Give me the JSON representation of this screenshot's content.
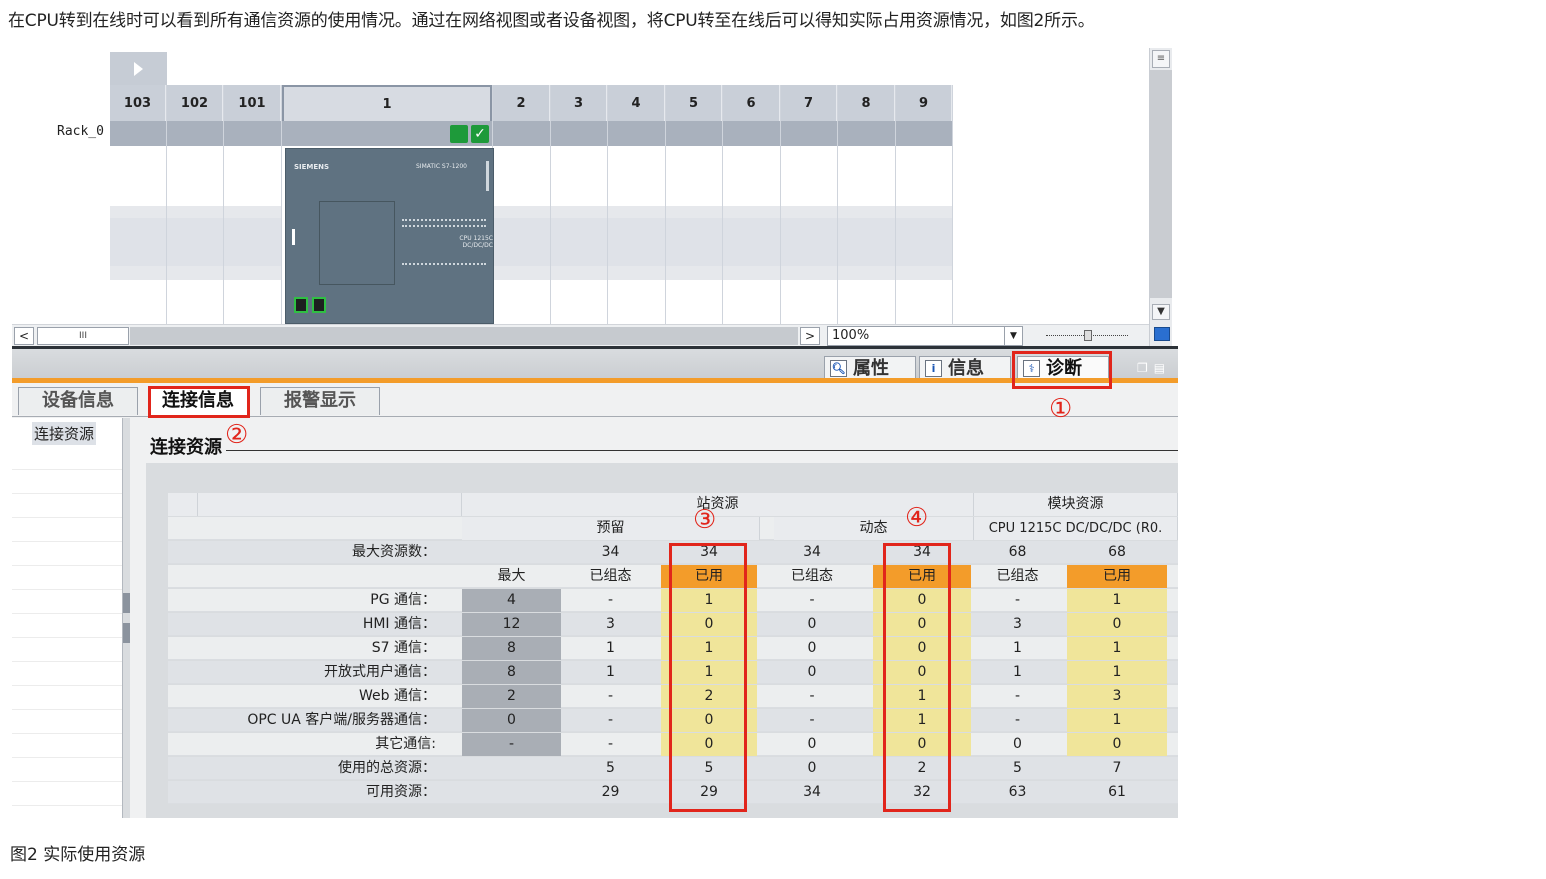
{
  "intro_text": "在CPU转到在线时可以看到所有通信资源的使用情况。通过在网络视图或者设备视图，将CPU转至在线后可以得知实际占用资源情况，如图2所示。",
  "caption": "图2 实际使用资源",
  "device_view": {
    "rack_label": "Rack_0",
    "slots": [
      "103",
      "102",
      "101",
      "1",
      "2",
      "3",
      "4",
      "5",
      "6",
      "7",
      "8",
      "9"
    ],
    "cpu_brand": "SIEMENS",
    "cpu_model": "SIMATIC S7-1200",
    "cpu_label": "CPU 1215C DC/DC/DC",
    "zoom": "100%",
    "scroll_thumb": "III"
  },
  "inspector_tabs": [
    {
      "label": "属性",
      "icon": "properties-icon"
    },
    {
      "label": "信息",
      "icon": "info-icon"
    },
    {
      "label": "诊断",
      "icon": "diagnostics-icon"
    }
  ],
  "sub_tabs": [
    "设备信息",
    "连接信息",
    "报警显示"
  ],
  "left_nav_item": "连接资源",
  "section_title": "连接资源",
  "table": {
    "group_station": "站资源",
    "group_module": "模块资源",
    "sub_reserved": "预留",
    "sub_dynamic": "动态",
    "sub_module": "CPU 1215C DC/DC/DC (R0.",
    "max_row_label": "最大资源数：",
    "max_row": [
      "",
      "34",
      "34",
      "34",
      "34",
      "68",
      "68"
    ],
    "col_heads": [
      "最大",
      "已组态",
      "已用",
      "已组态",
      "已用",
      "已组态",
      "已用"
    ],
    "rows": [
      {
        "label": "PG 通信：",
        "values": [
          "4",
          "-",
          "1",
          "-",
          "0",
          "-",
          "1"
        ]
      },
      {
        "label": "HMI 通信：",
        "values": [
          "12",
          "3",
          "0",
          "0",
          "0",
          "3",
          "0"
        ]
      },
      {
        "label": "S7 通信：",
        "values": [
          "8",
          "1",
          "1",
          "0",
          "0",
          "1",
          "1"
        ]
      },
      {
        "label": "开放式用户通信：",
        "values": [
          "8",
          "1",
          "1",
          "0",
          "0",
          "1",
          "1"
        ]
      },
      {
        "label": "Web 通信：",
        "values": [
          "2",
          "-",
          "2",
          "-",
          "1",
          "-",
          "3"
        ]
      },
      {
        "label": "OPC UA 客户端/服务器通信：",
        "values": [
          "0",
          "-",
          "0",
          "-",
          "1",
          "-",
          "1"
        ]
      },
      {
        "label": "其它通信:",
        "values": [
          "-",
          "-",
          "0",
          "0",
          "0",
          "0",
          "0"
        ]
      }
    ],
    "total_label": "使用的总资源：",
    "total": [
      "",
      "5",
      "5",
      "0",
      "2",
      "5",
      "7"
    ],
    "avail_label": "可用资源：",
    "avail": [
      "",
      "29",
      "29",
      "34",
      "32",
      "63",
      "61"
    ]
  },
  "markers": [
    "①",
    "②",
    "③",
    "④"
  ],
  "colors": {
    "callout": "#e1251b",
    "used_header": "#f39c2a",
    "used_cell": "#f0e59a",
    "max_cell": "#a9aeb5"
  }
}
